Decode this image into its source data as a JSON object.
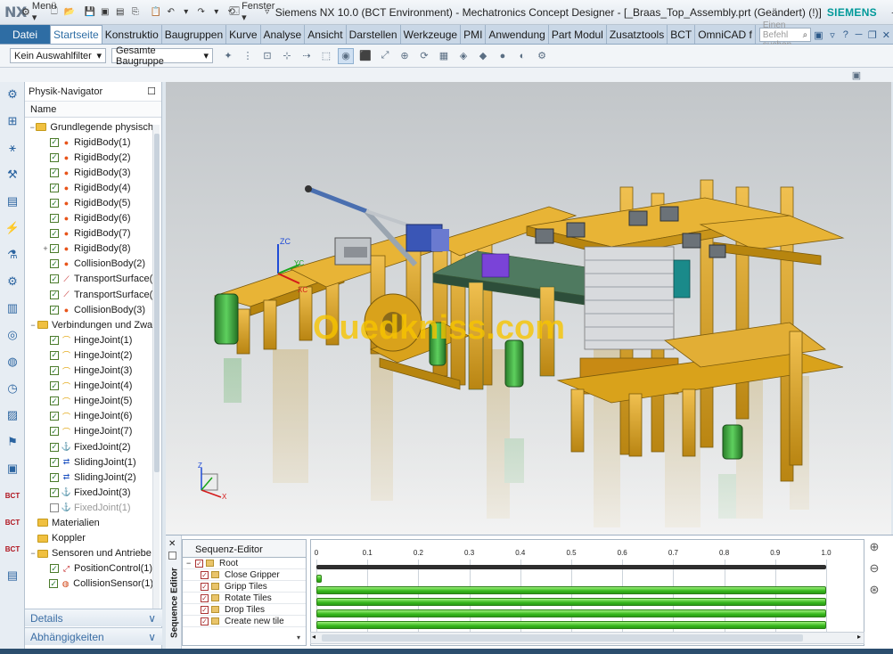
{
  "titlebar": {
    "logo": "NX",
    "menu_label": "Menü ▾",
    "window_label": "Fenster ▾",
    "title": "Siemens NX 10.0 (BCT Environment) - Mechatronics Concept Designer - [_Braas_Top_Assembly.prt (Geändert)   (!)]",
    "brand": "SIEMENS"
  },
  "ribbon": {
    "file_tab": "Datei",
    "tabs": [
      "Startseite",
      "Konstruktio",
      "Baugruppen",
      "Kurve",
      "Analyse",
      "Ansicht",
      "Darstellen",
      "Werkzeuge",
      "PMI",
      "Anwendung",
      "Part Modul",
      "Zusatztools",
      "BCT",
      "OmniCAD f"
    ],
    "active_tab": "Startseite",
    "search_placeholder": "Einen Befehl suchen"
  },
  "toolbar": {
    "selection_filter": "Kein Auswahlfilter",
    "scope": "Gesamte Baugruppe"
  },
  "navigator": {
    "title": "Physik-Navigator",
    "column_header": "Name",
    "items": [
      {
        "label": "Grundlegende physisch",
        "level": 0,
        "type": "folder",
        "expander": "−"
      },
      {
        "label": "RigidBody(1)",
        "level": 1,
        "type": "rigid",
        "checked": true
      },
      {
        "label": "RigidBody(2)",
        "level": 1,
        "type": "rigid",
        "checked": true
      },
      {
        "label": "RigidBody(3)",
        "level": 1,
        "type": "rigid",
        "checked": true
      },
      {
        "label": "RigidBody(4)",
        "level": 1,
        "type": "rigid",
        "checked": true
      },
      {
        "label": "RigidBody(5)",
        "level": 1,
        "type": "rigid",
        "checked": true
      },
      {
        "label": "RigidBody(6)",
        "level": 1,
        "type": "rigid",
        "checked": true
      },
      {
        "label": "RigidBody(7)",
        "level": 1,
        "type": "rigid",
        "checked": true
      },
      {
        "label": "RigidBody(8)",
        "level": 1,
        "type": "rigid",
        "checked": true,
        "expander": "+"
      },
      {
        "label": "CollisionBody(2)",
        "level": 1,
        "type": "rigid",
        "checked": true
      },
      {
        "label": "TransportSurface(",
        "level": 1,
        "type": "transport",
        "checked": true
      },
      {
        "label": "TransportSurface(",
        "level": 1,
        "type": "transport",
        "checked": true
      },
      {
        "label": "CollisionBody(3)",
        "level": 1,
        "type": "rigid",
        "checked": true
      },
      {
        "label": "Verbindungen und Zwa",
        "level": 0,
        "type": "folder",
        "expander": "−"
      },
      {
        "label": "HingeJoint(1)",
        "level": 1,
        "type": "joint",
        "checked": true
      },
      {
        "label": "HingeJoint(2)",
        "level": 1,
        "type": "joint",
        "checked": true
      },
      {
        "label": "HingeJoint(3)",
        "level": 1,
        "type": "joint",
        "checked": true
      },
      {
        "label": "HingeJoint(4)",
        "level": 1,
        "type": "joint",
        "checked": true
      },
      {
        "label": "HingeJoint(5)",
        "level": 1,
        "type": "joint",
        "checked": true
      },
      {
        "label": "HingeJoint(6)",
        "level": 1,
        "type": "joint",
        "checked": true
      },
      {
        "label": "HingeJoint(7)",
        "level": 1,
        "type": "joint",
        "checked": true
      },
      {
        "label": "FixedJoint(2)",
        "level": 1,
        "type": "fixed",
        "checked": true
      },
      {
        "label": "SlidingJoint(1)",
        "level": 1,
        "type": "sliding",
        "checked": true
      },
      {
        "label": "SlidingJoint(2)",
        "level": 1,
        "type": "sliding",
        "checked": true
      },
      {
        "label": "FixedJoint(3)",
        "level": 1,
        "type": "fixed",
        "checked": true
      },
      {
        "label": "FixedJoint(1)",
        "level": 1,
        "type": "fixed",
        "checked": false,
        "disabled": true
      },
      {
        "label": "Materialien",
        "level": 0,
        "type": "folder"
      },
      {
        "label": "Koppler",
        "level": 0,
        "type": "folder"
      },
      {
        "label": "Sensoren und Antriebe",
        "level": 0,
        "type": "folder",
        "expander": "−"
      },
      {
        "label": "PositionControl(1)",
        "level": 1,
        "type": "position",
        "checked": true
      },
      {
        "label": "CollisionSensor(1)",
        "level": 1,
        "type": "sensor",
        "checked": true
      }
    ],
    "details_label": "Details",
    "dependencies_label": "Abhängigkeiten"
  },
  "viewport": {
    "watermark": "Ouedkniss.com",
    "axis_labels": {
      "zc": "ZC",
      "xc": "XC",
      "yc": "YC",
      "z": "Z",
      "x": "X"
    }
  },
  "sequence_editor": {
    "side_label": "Sequence Editor",
    "header": "Sequenz-Editor",
    "rows": [
      {
        "label": "Root",
        "level": 0
      },
      {
        "label": "Close Gripper",
        "level": 1
      },
      {
        "label": "Gripp Tiles",
        "level": 1
      },
      {
        "label": "Rotate Tiles",
        "level": 1
      },
      {
        "label": "Drop Tiles",
        "level": 1
      },
      {
        "label": "Create new tile",
        "level": 1
      }
    ],
    "ticks": [
      "0",
      "0.1",
      "0.2",
      "0.3",
      "0.4",
      "0.5",
      "0.6",
      "0.7",
      "0.8",
      "0.9",
      "1.0"
    ],
    "timeline_end": 1.0,
    "bars": [
      {
        "row": "Root",
        "start": 0.0,
        "end": 1.0,
        "style": "dark"
      },
      {
        "row": "Close Gripper",
        "start": 0.0,
        "end": 0.01,
        "style": "green"
      },
      {
        "row": "Gripp Tiles",
        "start": 0.0,
        "end": 1.0,
        "style": "green"
      },
      {
        "row": "Rotate Tiles",
        "start": 0.0,
        "end": 1.0,
        "style": "green"
      },
      {
        "row": "Drop Tiles",
        "start": 0.0,
        "end": 1.0,
        "style": "green"
      },
      {
        "row": "Create new tile",
        "start": 0.0,
        "end": 1.0,
        "style": "green"
      }
    ]
  },
  "colors": {
    "accent": "#2e6da4",
    "brand": "#009999",
    "machine_frame": "#d9a21b",
    "motor": "#3aa53a",
    "bar_green": "#37b81d"
  }
}
